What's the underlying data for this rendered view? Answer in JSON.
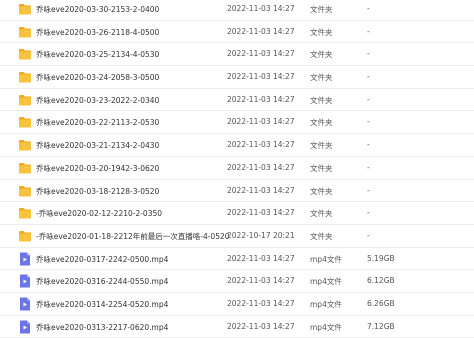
{
  "colors": {
    "folder": "#f9c23c",
    "folder_tab": "#f2a91f",
    "video": "#6b75e8",
    "divider": "#eeeeee"
  },
  "files": [
    {
      "icon": "folder-icon",
      "name": "乔咏eve2020-03-30-2153-2-0400",
      "date": "2022-11-03 14:27",
      "type": "文件夹",
      "size": "-"
    },
    {
      "icon": "folder-icon",
      "name": "乔咏eve2020-03-26-2118-4-0500",
      "date": "2022-11-03 14:27",
      "type": "文件夹",
      "size": "-"
    },
    {
      "icon": "folder-icon",
      "name": "乔咏eve2020-03-25-2134-4-0530",
      "date": "2022-11-03 14:27",
      "type": "文件夹",
      "size": "-"
    },
    {
      "icon": "folder-icon",
      "name": "乔咏eve2020-03-24-2058-3-0500",
      "date": "2022-11-03 14:27",
      "type": "文件夹",
      "size": "-"
    },
    {
      "icon": "folder-icon",
      "name": "乔咏eve2020-03-23-2022-2-0340",
      "date": "2022-11-03 14:27",
      "type": "文件夹",
      "size": "-"
    },
    {
      "icon": "folder-icon",
      "name": "乔咏eve2020-03-22-2113-2-0530",
      "date": "2022-11-03 14:27",
      "type": "文件夹",
      "size": "-"
    },
    {
      "icon": "folder-icon",
      "name": "乔咏eve2020-03-21-2134-2-0430",
      "date": "2022-11-03 14:27",
      "type": "文件夹",
      "size": "-"
    },
    {
      "icon": "folder-icon",
      "name": "乔咏eve2020-03-20-1942-3-0620",
      "date": "2022-11-03 14:27",
      "type": "文件夹",
      "size": "-"
    },
    {
      "icon": "folder-icon",
      "name": "乔咏eve2020-03-18-2128-3-0520",
      "date": "2022-11-03 14:27",
      "type": "文件夹",
      "size": "-"
    },
    {
      "icon": "folder-icon",
      "name": "-乔咏eve2020-02-12-2210-2-0350",
      "date": "2022-11-03 14:27",
      "type": "文件夹",
      "size": "-"
    },
    {
      "icon": "folder-icon",
      "name": "-乔咏eve2020-01-18-2212年前最后一次直播咯-4-0520",
      "date": "2022-10-17 20:21",
      "type": "文件夹",
      "size": "-"
    },
    {
      "icon": "video-icon",
      "name": "乔咏eve2020-0317-2242-0500.mp4",
      "date": "2022-11-03 14:27",
      "type": "mp4文件",
      "size": "5.19GB"
    },
    {
      "icon": "video-icon",
      "name": "乔咏eve2020-0316-2244-0550.mp4",
      "date": "2022-11-03 14:27",
      "type": "mp4文件",
      "size": "6.12GB"
    },
    {
      "icon": "video-icon",
      "name": "乔咏eve2020-0314-2254-0520.mp4",
      "date": "2022-11-03 14:27",
      "type": "mp4文件",
      "size": "6.26GB"
    },
    {
      "icon": "video-icon",
      "name": "乔咏eve2020-0313-2217-0620.mp4",
      "date": "2022-11-03 14:27",
      "type": "mp4文件",
      "size": "7.12GB"
    }
  ]
}
